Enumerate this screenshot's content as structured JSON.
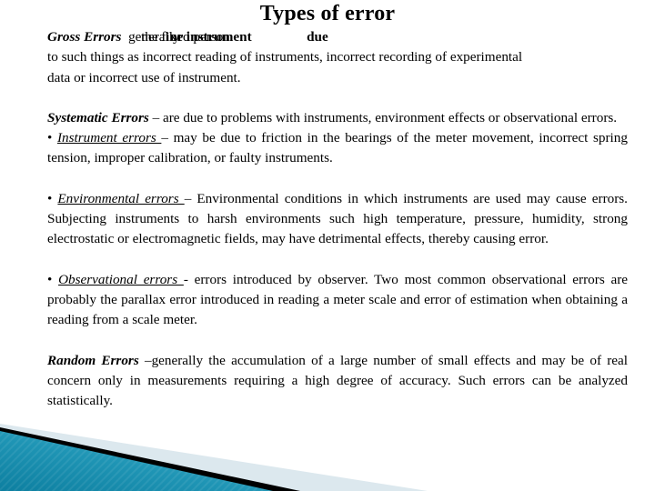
{
  "slide": {
    "title": "Types of error",
    "background_color": "#ffffff",
    "text_color": "#000000"
  },
  "content": {
    "gross": {
      "lead": "Gross Errors",
      "overlap_run_a": "generally",
      "overlap_run_b": "the fixed person",
      "overlap_run_c": "or instrument",
      "overlap_run_d": "due",
      "line_2": "to such things as incorrect reading of instruments, incorrect recording of experimental",
      "line_3": "data or incorrect use of instrument."
    },
    "systematic": {
      "lead": "Systematic  Errors",
      "body": " –  are  due  to  problems  with  instruments,  environment  effects  or observational errors."
    },
    "instrument": {
      "bullet": "• ",
      "lead": "Instrument  errors ",
      "body": "– may  be  due  to  friction  in  the  bearings  of  the  meter  movement, incorrect spring tension, improper calibration, or faulty instruments."
    },
    "environmental": {
      "bullet": "• ",
      "lead": "Environmental errors ",
      "body": "– Environmental conditions in which instruments are used may cause  errors.  Subjecting  instruments  to  harsh  environments  such  high  temperature, pressure, humidity, strong electrostatic or electromagnetic fields, may have detrimental effects, thereby causing error."
    },
    "observational": {
      "bullet": "• ",
      "lead": "Observational errors ",
      "body": "- errors introduced by observer. Two most common observational errors  are  probably  the  parallax  error  introduced  in  reading  a  meter  scale  and  error  of estimation when obtaining a reading from a scale meter."
    },
    "random": {
      "lead": "Random Errors",
      "body": " –generally the accumulation of a large number of small effects and may be  of  real  concern  only  in  measurements  requiring  a  high  degree  of  accuracy.  Such errors can be analyzed statistically."
    }
  },
  "decoration": {
    "name": "corner-banner",
    "teal_light": "#45b3cc",
    "teal_mid": "#1f95b5",
    "teal_dark": "#0d7fa0",
    "stripe_black": "#000000",
    "pale_band": "#dce8ee"
  }
}
